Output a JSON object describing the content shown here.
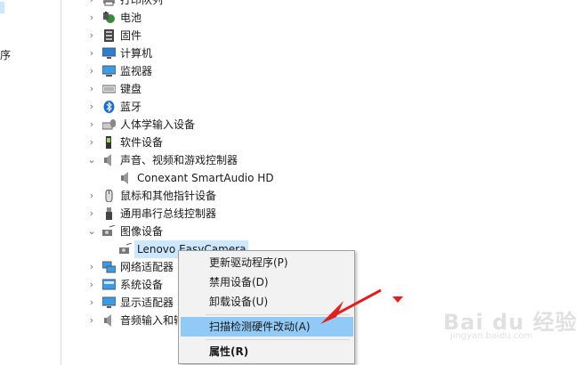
{
  "left_pane": {
    "fragment": "序"
  },
  "tree": {
    "rows": [
      {
        "label": "打印队列",
        "chevron": "›",
        "icon": "printer-icon"
      },
      {
        "label": "电池",
        "chevron": "›",
        "icon": "battery-icon"
      },
      {
        "label": "固件",
        "chevron": "›",
        "icon": "firmware-icon"
      },
      {
        "label": "计算机",
        "chevron": "›",
        "icon": "computer-icon"
      },
      {
        "label": "监视器",
        "chevron": "›",
        "icon": "monitor-icon"
      },
      {
        "label": "键盘",
        "chevron": "›",
        "icon": "keyboard-icon"
      },
      {
        "label": "蓝牙",
        "chevron": "›",
        "icon": "bluetooth-icon"
      },
      {
        "label": "人体学输入设备",
        "chevron": "›",
        "icon": "hid-icon"
      },
      {
        "label": "软件设备",
        "chevron": "›",
        "icon": "software-device-icon"
      },
      {
        "label": "声音、视频和游戏控制器",
        "chevron": "⌄",
        "icon": "speaker-icon"
      },
      {
        "label": "Conexant SmartAudio HD",
        "chevron": "",
        "icon": "speaker-icon"
      },
      {
        "label": "鼠标和其他指针设备",
        "chevron": "›",
        "icon": "mouse-icon"
      },
      {
        "label": "通用串行总线控制器",
        "chevron": "›",
        "icon": "usb-icon"
      },
      {
        "label": "图像设备",
        "chevron": "⌄",
        "icon": "camera-icon"
      },
      {
        "label": "Lenovo EasyCamera",
        "chevron": "",
        "icon": "camera-icon"
      },
      {
        "label": "网络适配器",
        "chevron": "›",
        "icon": "network-adapter-icon"
      },
      {
        "label": "系统设备",
        "chevron": "›",
        "icon": "system-device-icon"
      },
      {
        "label": "显示适配器",
        "chevron": "›",
        "icon": "display-adapter-icon"
      },
      {
        "label": "音频输入和输出",
        "chevron": "›",
        "icon": "audio-io-icon"
      }
    ]
  },
  "context_menu": {
    "update_driver": "更新驱动程序(P)",
    "disable_device": "禁用设备(D)",
    "uninstall_device": "卸载设备(U)",
    "scan_hardware": "扫描检测硬件改动(A)",
    "properties": "属性(R)"
  },
  "watermark": {
    "logo": "Bai du 经验",
    "url": "jingyan.baidu.com"
  },
  "colors": {
    "annotation_red": "#e02020",
    "selection": "#cce8ff",
    "menu_hover": "#91c9f7"
  }
}
